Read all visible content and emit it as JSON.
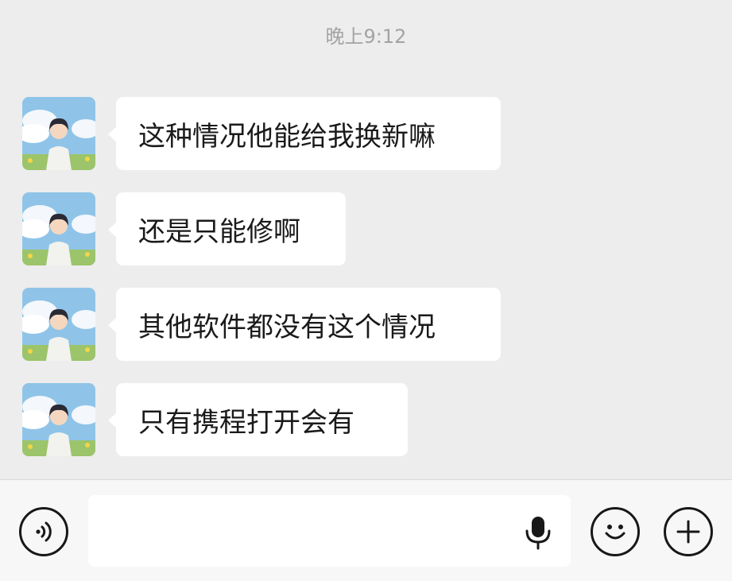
{
  "chat": {
    "timestamp": "晚上9:12",
    "messages": [
      {
        "sender": "other",
        "text": "这种情况他能给我换新嘛"
      },
      {
        "sender": "other",
        "text": "还是只能修啊"
      },
      {
        "sender": "other",
        "text": "其他软件都没有这个情况"
      },
      {
        "sender": "other",
        "text": "只有携程打开会有"
      }
    ]
  },
  "input_bar": {
    "message_value": "",
    "icons": {
      "left": "voice-wave-icon",
      "inside_input": "microphone-icon",
      "emoji": "smiley-face-icon",
      "more": "plus-circle-icon"
    }
  },
  "colors": {
    "background": "#ededed",
    "bubble": "#ffffff",
    "timestamp": "#a3a3a3",
    "input_bar": "#f7f7f7"
  }
}
